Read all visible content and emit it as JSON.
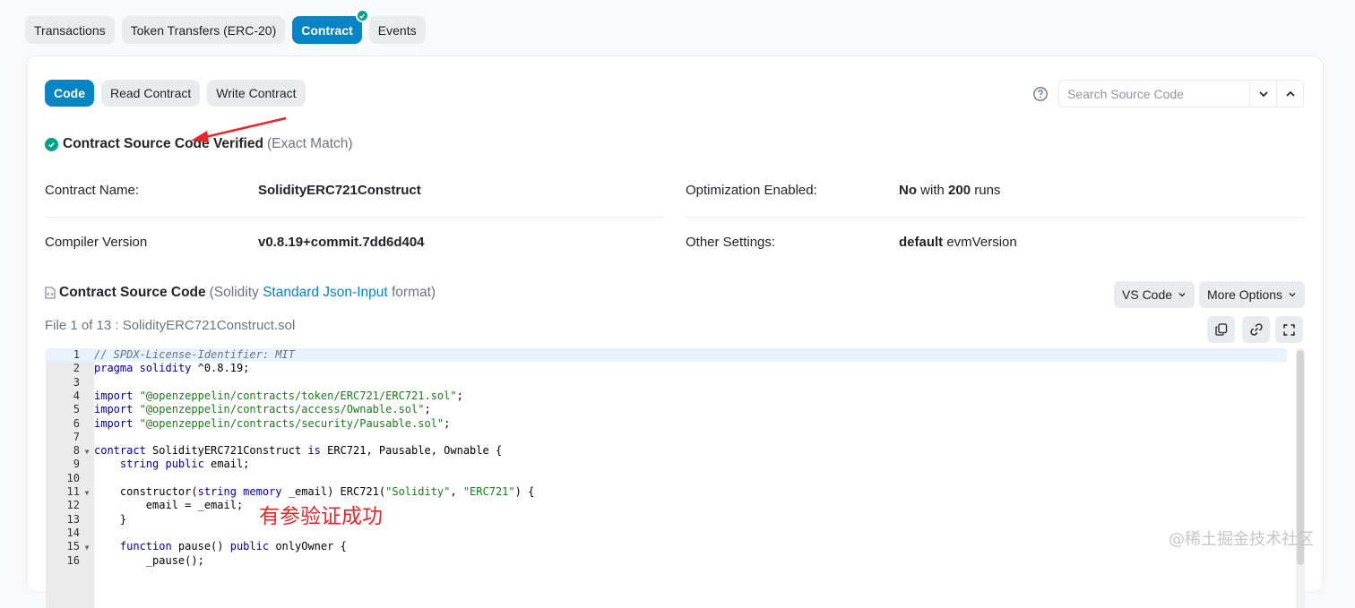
{
  "top_tabs": [
    {
      "label": "Transactions"
    },
    {
      "label": "Token Transfers (ERC-20)"
    },
    {
      "label": "Contract"
    },
    {
      "label": "Events"
    }
  ],
  "sub_tabs": [
    {
      "label": "Code"
    },
    {
      "label": "Read Contract"
    },
    {
      "label": "Write Contract"
    }
  ],
  "search": {
    "placeholder": "Search Source Code"
  },
  "verification": {
    "title": "Contract Source Code Verified",
    "match": "(Exact Match)"
  },
  "info": {
    "contract_name_label": "Contract Name:",
    "contract_name_value": "SolidityERC721Construct",
    "optimization_label": "Optimization Enabled:",
    "optimization_value_bold": "No",
    "optimization_value_mid": "with",
    "optimization_runs": "200",
    "optimization_value_end": "runs",
    "compiler_label": "Compiler Version",
    "compiler_value": "v0.8.19+commit.7dd6d404",
    "other_label": "Other Settings:",
    "other_value_bold": "default",
    "other_value_rest": "evmVersion"
  },
  "source": {
    "title": "Contract Source Code",
    "paren_open": "(Solidity",
    "link": "Standard Json-Input",
    "paren_close": "format)",
    "vscode_label": "VS Code",
    "more_options_label": "More Options",
    "file_line": "File 1 of 13 : SolidityERC721Construct.sol"
  },
  "code": {
    "line_numbers": [
      "1",
      "2",
      "3",
      "4",
      "5",
      "6",
      "7",
      "8",
      "9",
      "10",
      "11",
      "12",
      "13",
      "14",
      "15",
      "16"
    ],
    "line_1": "// SPDX-License-Identifier: MIT",
    "line_2_kw": "pragma solidity",
    "line_2_rest": " ^0.8.19;",
    "import_kw": "import",
    "line_4_str": "\"@openzeppelin/contracts/token/ERC721/ERC721.sol\"",
    "line_5_str": "\"@openzeppelin/contracts/access/Ownable.sol\"",
    "line_6_str": "\"@openzeppelin/contracts/security/Pausable.sol\"",
    "semicolon": ";",
    "line_8_kw": "contract",
    "line_8_name": " SolidityERC721Construct ",
    "line_8_is": "is",
    "line_8_rest": " ERC721, Pausable, Ownable {",
    "line_9_kw": "string public",
    "line_9_rest": " email;",
    "line_11_a": "constructor(",
    "line_11_kw1": "string memory",
    "line_11_b": " _email) ERC721(",
    "line_11_s1": "\"Solidity\"",
    "line_11_c": ", ",
    "line_11_s2": "\"ERC721\"",
    "line_11_d": ") {",
    "line_12": "email = _email;",
    "line_13": "}",
    "line_15_kw": "function",
    "line_15_a": " pause() ",
    "line_15_kw2": "public",
    "line_15_b": " onlyOwner {",
    "line_16": "_pause();"
  },
  "annotation": "有参验证成功",
  "watermark": "@稀土掘金技术社区",
  "colors": {
    "primary": "#0784c3",
    "success": "#00a186",
    "annotation": "#e5262a"
  }
}
